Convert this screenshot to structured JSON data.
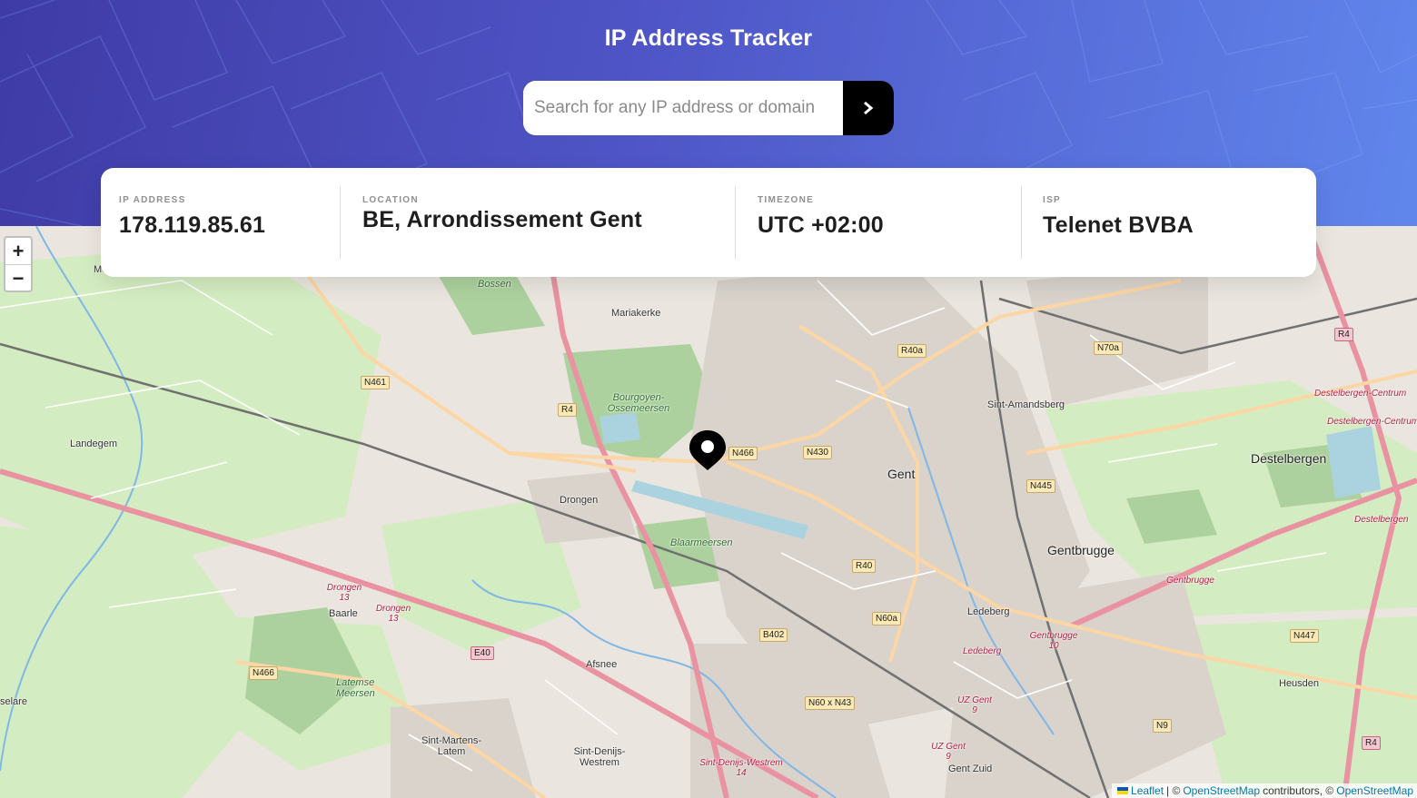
{
  "header": {
    "title": "IP Address Tracker",
    "search": {
      "placeholder": "Search for any IP address or domain",
      "value": "",
      "button_icon": "chevron-right-icon"
    }
  },
  "info": {
    "ip": {
      "label": "IP ADDRESS",
      "value": "178.119.85.61"
    },
    "location": {
      "label": "LOCATION",
      "value": "BE, Arrondissement Gent"
    },
    "timezone": {
      "label": "TIMEZONE",
      "value": "UTC +02:00"
    },
    "isp": {
      "label": "ISP",
      "value": "Telenet BVBA"
    }
  },
  "map": {
    "zoom_in": "+",
    "zoom_out": "−",
    "marker_icon": "location-pin-icon",
    "attribution": {
      "leaflet": "Leaflet",
      "separator": "| ©",
      "osm": "OpenStreetMap",
      "contributors": "contributors, ©",
      "osm2": "OpenStreetMap"
    },
    "labels": {
      "gent": "Gent",
      "gentbrugge": "Gentbrugge",
      "destelbergen": "Destelbergen",
      "sint_amandsberg": "Sint-Amandsberg",
      "mariakerke": "Mariakerke",
      "drongen": "Drongen",
      "landegem": "Landegem",
      "baarle": "Baarle",
      "afsnee": "Afsnee",
      "ledeberg": "Ledeberg",
      "heusden": "Heusden",
      "sint_martens_latem": "Sint-Martens-Latem",
      "sint_denijs_westrem": "Sint-Denijs-Westrem",
      "bourgoyen": "Bourgoyen-Ossemeersen",
      "blaarmeersen": "Blaarmeersen",
      "latemse_meersen": "Latemse Meersen",
      "bossen": "Bossen",
      "gent_zuid": "Gent Zuid",
      "me": "Me",
      "selare": "selare"
    },
    "shields": {
      "r4": "R4",
      "n461": "N461",
      "n466": "N466",
      "n430": "N430",
      "r40a": "R40a",
      "n70a": "N70a",
      "n445": "N445",
      "r40": "R40",
      "n60a": "N60a",
      "b402": "B402",
      "e40": "E40",
      "n60xn43": "N60 x N43",
      "n447": "N447",
      "n9": "N9"
    },
    "pink_labels": {
      "destelbergen_centrum": "Destelbergen-Centrum",
      "destelbergen_centrum2": "Destelbergen-Centrum",
      "destelbergen": "Destelbergen",
      "gentbrugge": "Gentbrugge",
      "drongen13": "Drongen 13",
      "drongen13b": "Drongen 13",
      "gentbrugge10": "Gentbrugge 10",
      "ledeberg": "Ledeberg",
      "uz_gent": "UZ Gent 9",
      "uz_gent2": "UZ Gent 9",
      "sint_denijs": "Sint-Denijs-Westrem 14"
    }
  }
}
